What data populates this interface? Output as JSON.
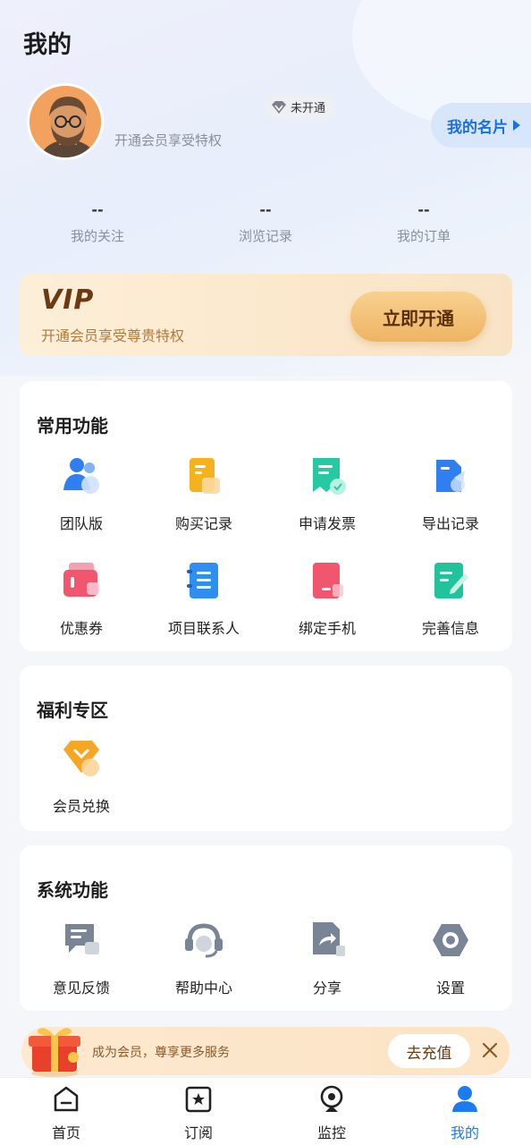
{
  "header": {
    "title": "我的"
  },
  "profile": {
    "username": "        ",
    "vip_status": "未开通",
    "subtitle": "开通会员享受特权",
    "card_button": "我的名片"
  },
  "stats": [
    {
      "value": "--",
      "label": "我的关注"
    },
    {
      "value": "--",
      "label": "浏览记录"
    },
    {
      "value": "--",
      "label": "我的订单"
    }
  ],
  "vip_banner": {
    "logo": "VIP",
    "subtitle": "开通会员享受尊贵特权",
    "button": "立即开通"
  },
  "common": {
    "title": "常用功能",
    "items": [
      {
        "label": "团队版",
        "icon": "team-icon"
      },
      {
        "label": "购买记录",
        "icon": "purchase-record-icon"
      },
      {
        "label": "申请发票",
        "icon": "invoice-icon"
      },
      {
        "label": "导出记录",
        "icon": "export-record-icon"
      },
      {
        "label": "优惠券",
        "icon": "coupon-icon"
      },
      {
        "label": "项目联系人",
        "icon": "project-contact-icon"
      },
      {
        "label": "绑定手机",
        "icon": "bind-phone-icon"
      },
      {
        "label": "完善信息",
        "icon": "edit-info-icon"
      }
    ]
  },
  "welfare": {
    "title": "福利专区",
    "items": [
      {
        "label": "会员兑换",
        "icon": "member-exchange-icon"
      }
    ]
  },
  "system": {
    "title": "系统功能",
    "items": [
      {
        "label": "意见反馈",
        "icon": "feedback-icon"
      },
      {
        "label": "帮助中心",
        "icon": "help-center-icon"
      },
      {
        "label": "分享",
        "icon": "share-icon"
      },
      {
        "label": "设置",
        "icon": "settings-icon"
      }
    ]
  },
  "promo": {
    "text": "成为会员，尊享更多服务",
    "button": "去充值"
  },
  "tabbar": [
    {
      "label": "首页",
      "icon": "home-icon"
    },
    {
      "label": "订阅",
      "icon": "subscribe-icon"
    },
    {
      "label": "监控",
      "icon": "monitor-icon"
    },
    {
      "label": "我的",
      "icon": "profile-icon",
      "active": true
    }
  ],
  "colors": {
    "accent": "#1d7bf0",
    "vip_gold": "#eeb463",
    "vip_brown": "#6b3a12"
  }
}
